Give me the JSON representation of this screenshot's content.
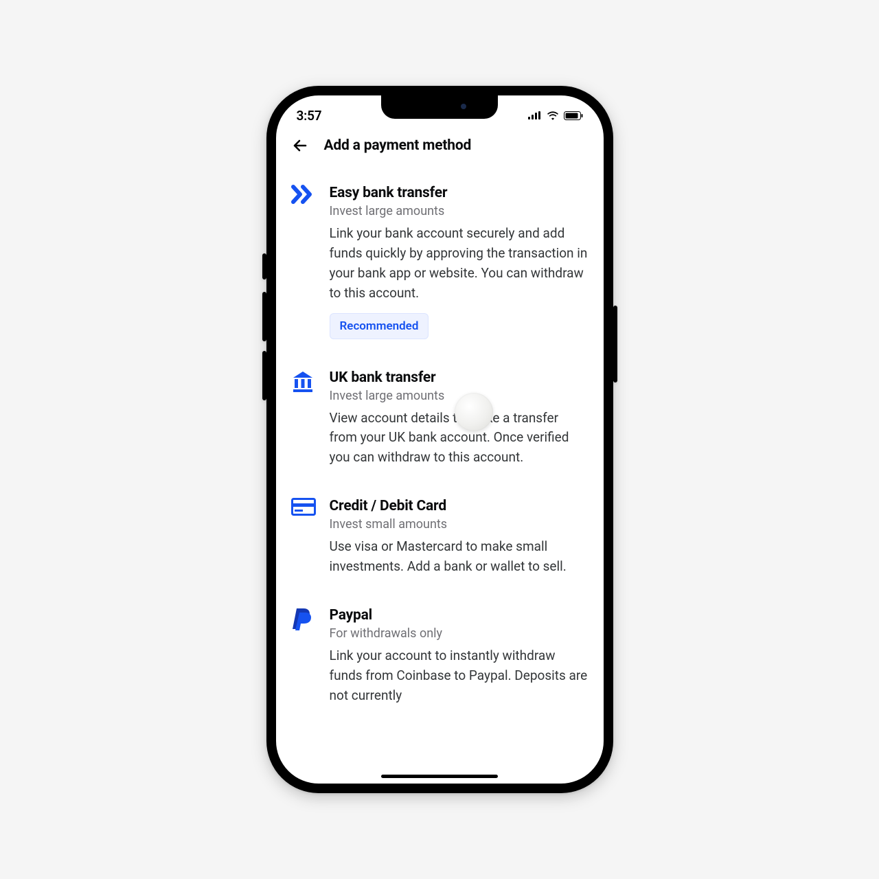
{
  "status": {
    "time": "3:57"
  },
  "header": {
    "title": "Add a payment method"
  },
  "methods": [
    {
      "id": "easy-bank-transfer",
      "icon": "chevrons-right-icon",
      "title": "Easy bank transfer",
      "subtitle": "Invest large amounts",
      "description": "Link your bank account securely and add funds quickly by approving the transaction in your bank app or website. You can withdraw to this account.",
      "badge": "Recommended"
    },
    {
      "id": "uk-bank-transfer",
      "icon": "bank-icon",
      "title": "UK bank transfer",
      "subtitle": "Invest large amounts",
      "description": "View account details to make a transfer from your UK bank account. Once verified you can withdraw to this account."
    },
    {
      "id": "credit-debit-card",
      "icon": "credit-card-icon",
      "title": "Credit / Debit Card",
      "subtitle": "Invest small amounts",
      "description": "Use visa or Mastercard to make small investments. Add a bank or wallet to sell."
    },
    {
      "id": "paypal",
      "icon": "paypal-icon",
      "title": "Paypal",
      "subtitle": "For withdrawals only",
      "description": "Link your account to instantly withdraw funds from Coinbase to Paypal. Deposits are not currently"
    }
  ],
  "colors": {
    "brand": "#1652f0",
    "text": "#0a0b0d",
    "muted": "#6f6f74",
    "badge_bg": "#eef2ff"
  }
}
